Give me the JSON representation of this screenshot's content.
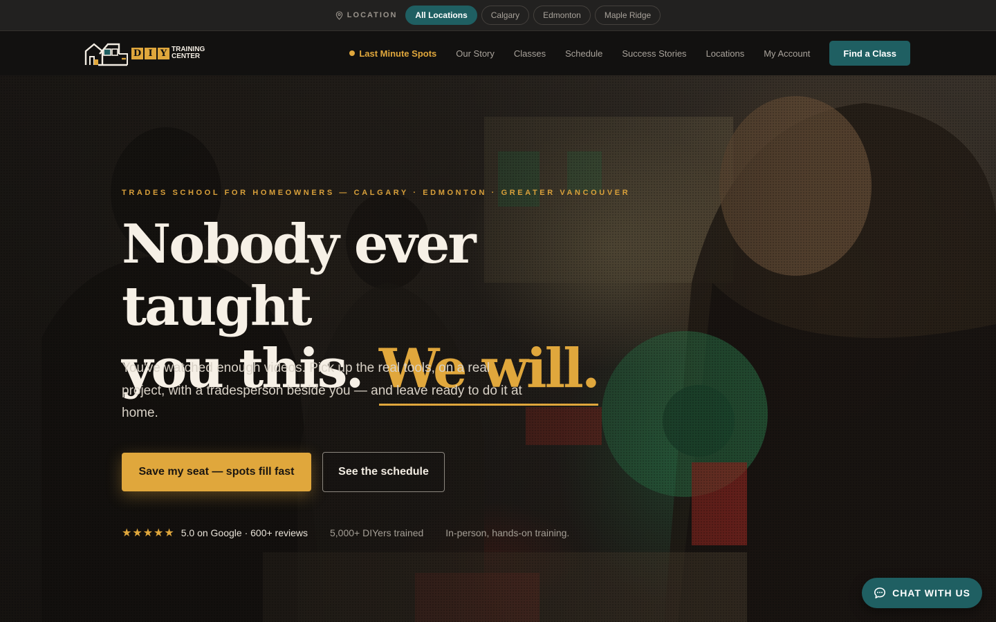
{
  "location_bar": {
    "label": "LOCATION",
    "options": [
      "All Locations",
      "Calgary",
      "Edmonton",
      "Maple Ridge"
    ],
    "selected": "All Locations"
  },
  "header": {
    "logo": {
      "letters": [
        "D",
        "I",
        "Y"
      ],
      "line1": "TRAINING",
      "line2": "CENTER"
    },
    "nav": {
      "last_minute": "Last Minute Spots",
      "our_story": "Our Story",
      "classes": "Classes",
      "schedule": "Schedule",
      "success_stories": "Success Stories",
      "locations": "Locations",
      "my_account": "My Account"
    },
    "cta": "Find a Class"
  },
  "hero": {
    "eyebrow": "TRADES SCHOOL FOR HOMEOWNERS — CALGARY · EDMONTON · GREATER VANCOUVER",
    "headline_line1": "Nobody ever taught",
    "headline_line2": "you this.",
    "headline_accent": "We will.",
    "subcopy": "You've watched enough videos. Pick up the real tools, on a real project, with a tradesperson beside you — and leave ready to do it at home.",
    "primary_cta": "Save my seat — spots fill fast",
    "secondary_cta": "See the schedule",
    "proof": {
      "stars": "★★★★★",
      "rating": "5.0 on Google · 600+ reviews",
      "trained": "5,000+ DIYers trained",
      "format": "In-person, hands-on training."
    }
  },
  "chat": {
    "label": "CHAT WITH US",
    "icon": "chat-bubble-icon"
  },
  "colors": {
    "accent": "#e0a73c",
    "teal": "#1f5f62",
    "header_bg": "#121110",
    "locbar_bg": "#222120"
  }
}
